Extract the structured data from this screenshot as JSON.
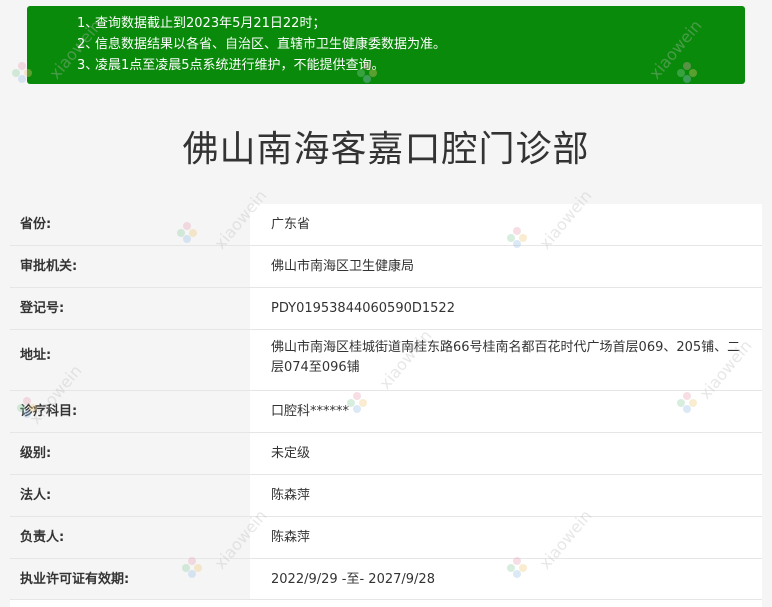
{
  "notice": {
    "items": [
      {
        "num": "1、",
        "text": "查询数据截止到2023年5月21日22时；"
      },
      {
        "num": "2、",
        "text": "信息数据结果以各省、自治区、直辖市卫生健康委数据为准。"
      },
      {
        "num": "3、",
        "text": "凌晨1点至凌晨5点系统进行维护，不能提供查询。"
      }
    ]
  },
  "title": "佛山南海客嘉口腔门诊部",
  "rows": [
    {
      "label": "省份:",
      "value": "广东省"
    },
    {
      "label": "审批机关:",
      "value": "佛山市南海区卫生健康局"
    },
    {
      "label": "登记号:",
      "value": "PDY01953844060590D1522"
    },
    {
      "label": "地址:",
      "value": "佛山市南海区桂城街道南桂东路66号桂南名都百花时代广场首层069、205铺、二层074至096铺"
    },
    {
      "label": "诊疗科目:",
      "value": "口腔科******"
    },
    {
      "label": "级别:",
      "value": "未定级"
    },
    {
      "label": "法人:",
      "value": "陈森萍"
    },
    {
      "label": "负责人:",
      "value": "陈森萍"
    },
    {
      "label": "执业许可证有效期:",
      "value": "2022/9/29 -至- 2027/9/28"
    }
  ],
  "watermark": {
    "text": "xiaowein",
    "color": "#bdbdbd"
  },
  "colors": {
    "notice_bg": "#0a8a0a",
    "page_bg": "#f5f5f5"
  }
}
